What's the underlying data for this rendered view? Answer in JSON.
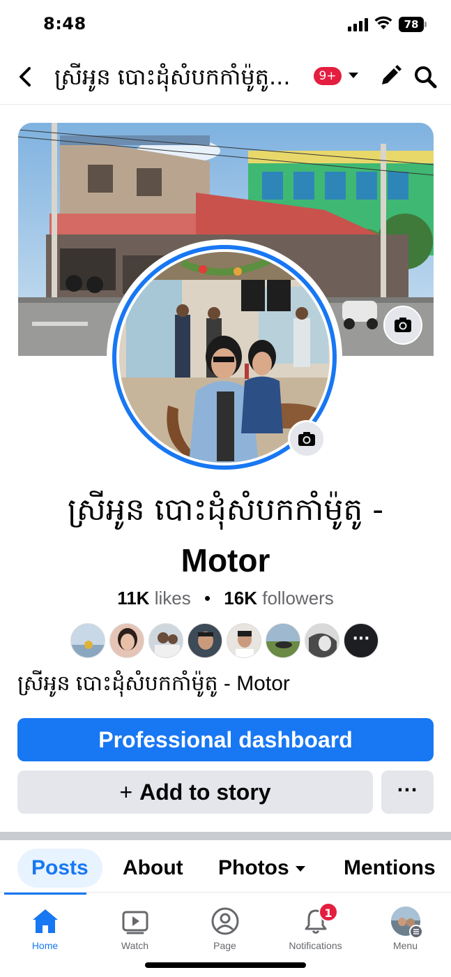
{
  "status_bar": {
    "time": "8:48",
    "battery": "78"
  },
  "nav": {
    "title": "ស្រីអូន បោះដុំសំបកកាំម៉ូតូ...",
    "badge": "9+"
  },
  "page": {
    "name_khmer": "ស្រីអូន បោះដុំសំបកកាំម៉ូតូ -",
    "name_latin": "Motor",
    "likes_count": "11K",
    "likes_label": "likes",
    "followers_count": "16K",
    "followers_label": "followers",
    "bio": "ស្រីអូន បោះដុំសំបកកាំម៉ូតូ - Motor"
  },
  "buttons": {
    "professional_dashboard": "Professional dashboard",
    "add_to_story_plus": "+",
    "add_to_story": "Add to story",
    "more": "···"
  },
  "follower_avatars": {
    "more_label": "···",
    "colors": [
      "#c9d8e6",
      "#e6c4b5",
      "#cfd7de",
      "#a9775a",
      "#e8e4df",
      "#7d9a5c",
      "#c7c7c7"
    ]
  },
  "tabs": [
    {
      "label": "Posts"
    },
    {
      "label": "About"
    },
    {
      "label": "Photos"
    },
    {
      "label": "Mentions"
    }
  ],
  "bottom_nav": [
    {
      "label": "Home"
    },
    {
      "label": "Watch"
    },
    {
      "label": "Page"
    },
    {
      "label": "Notifications",
      "badge": "1"
    },
    {
      "label": "Menu"
    }
  ],
  "colors": {
    "brand_blue": "#1877f2",
    "badge_red": "#e41e3f",
    "secondary_bg": "#e4e6eb",
    "muted_text": "#65676b"
  }
}
